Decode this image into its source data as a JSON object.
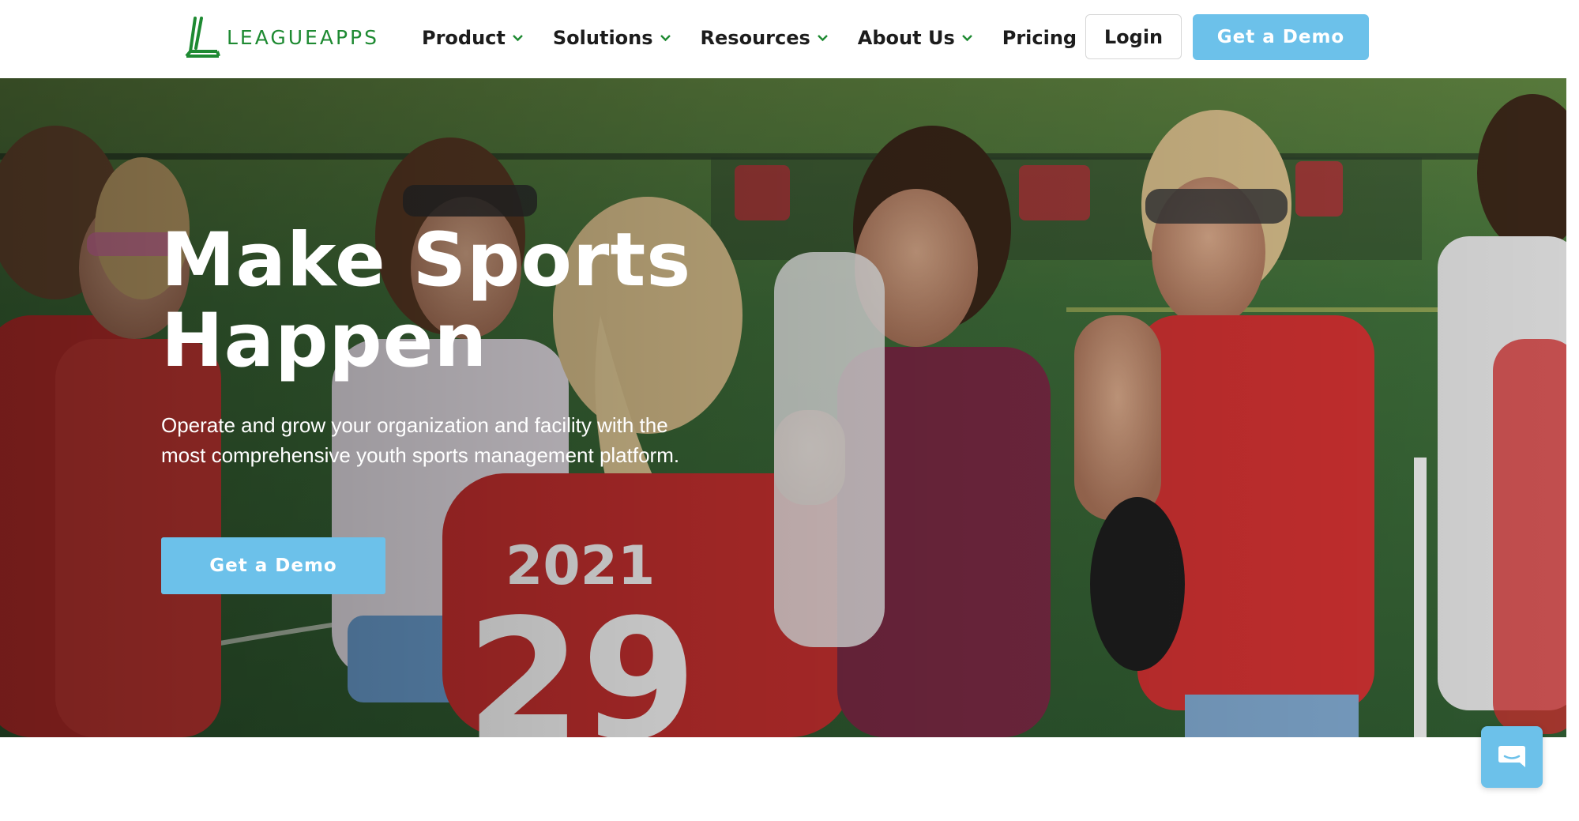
{
  "nav": {
    "logo_text": "LEAGUEAPPS",
    "menu": [
      {
        "label": "Product",
        "has_dropdown": true
      },
      {
        "label": "Solutions",
        "has_dropdown": true
      },
      {
        "label": "Resources",
        "has_dropdown": true
      },
      {
        "label": "About Us",
        "has_dropdown": true
      },
      {
        "label": "Pricing",
        "has_dropdown": false
      }
    ],
    "login_label": "Login",
    "demo_label": "Get a Demo"
  },
  "hero": {
    "title": "Make Sports Happen",
    "subtitle": "Operate and grow your organization and facility with the most comprehensive youth sports management platform.",
    "cta_label": "Get a Demo"
  },
  "icons": {
    "logo": "leagueapps-logo-icon",
    "dropdown": "chevron-down-icon",
    "chat": "chat-bubble-icon"
  },
  "colors": {
    "brand_green": "#1e8a32",
    "accent_blue": "#6cc1ea",
    "nav_text": "#1c1c1c",
    "hero_text": "#ffffff"
  }
}
